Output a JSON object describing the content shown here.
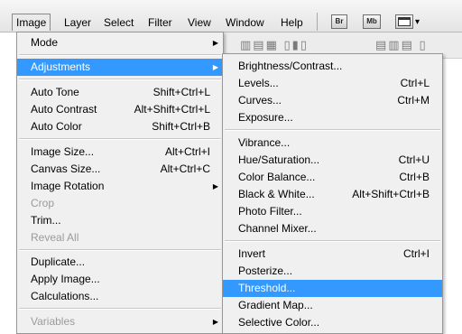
{
  "menubar": {
    "items": [
      "Image",
      "Layer",
      "Select",
      "Filter",
      "View",
      "Window",
      "Help"
    ],
    "bridge_label": "Br",
    "minibridge_label": "Mb",
    "arrange_arrow": "▾"
  },
  "image_menu": {
    "mode": "Mode",
    "adjustments": "Adjustments",
    "auto_tone": {
      "label": "Auto Tone",
      "shortcut": "Shift+Ctrl+L"
    },
    "auto_contrast": {
      "label": "Auto Contrast",
      "shortcut": "Alt+Shift+Ctrl+L"
    },
    "auto_color": {
      "label": "Auto Color",
      "shortcut": "Shift+Ctrl+B"
    },
    "image_size": {
      "label": "Image Size...",
      "shortcut": "Alt+Ctrl+I"
    },
    "canvas_size": {
      "label": "Canvas Size...",
      "shortcut": "Alt+Ctrl+C"
    },
    "image_rotation": "Image Rotation",
    "crop": "Crop",
    "trim": "Trim...",
    "reveal_all": "Reveal All",
    "duplicate": "Duplicate...",
    "apply_image": "Apply Image...",
    "calculations": "Calculations...",
    "variables": "Variables"
  },
  "adjust_menu": {
    "brightness_contrast": {
      "label": "Brightness/Contrast...",
      "shortcut": ""
    },
    "levels": {
      "label": "Levels...",
      "shortcut": "Ctrl+L"
    },
    "curves": {
      "label": "Curves...",
      "shortcut": "Ctrl+M"
    },
    "exposure": {
      "label": "Exposure...",
      "shortcut": ""
    },
    "vibrance": {
      "label": "Vibrance...",
      "shortcut": ""
    },
    "hue_saturation": {
      "label": "Hue/Saturation...",
      "shortcut": "Ctrl+U"
    },
    "color_balance": {
      "label": "Color Balance...",
      "shortcut": "Ctrl+B"
    },
    "black_white": {
      "label": "Black & White...",
      "shortcut": "Alt+Shift+Ctrl+B"
    },
    "photo_filter": {
      "label": "Photo Filter...",
      "shortcut": ""
    },
    "channel_mixer": {
      "label": "Channel Mixer...",
      "shortcut": ""
    },
    "invert": {
      "label": "Invert",
      "shortcut": "Ctrl+I"
    },
    "posterize": {
      "label": "Posterize...",
      "shortcut": ""
    },
    "threshold": {
      "label": "Threshold...",
      "shortcut": ""
    },
    "gradient_map": {
      "label": "Gradient Map...",
      "shortcut": ""
    },
    "selective_color": {
      "label": "Selective Color...",
      "shortcut": ""
    }
  },
  "colors": {
    "highlight": "#3399ff",
    "menu_bg": "#f0f0f0",
    "disabled": "#9a9a9a"
  }
}
